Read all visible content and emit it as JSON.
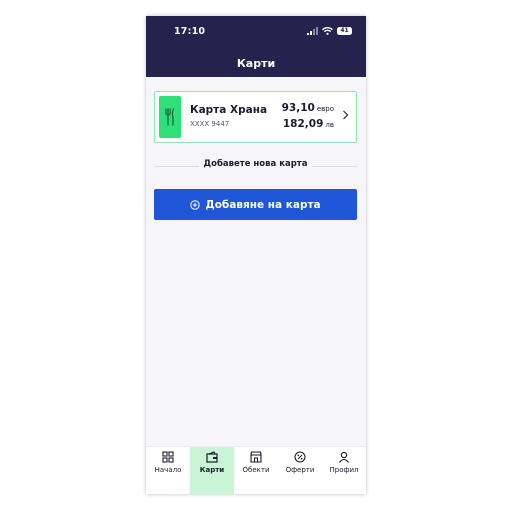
{
  "status_bar": {
    "time": "17:10",
    "battery": "41"
  },
  "header": {
    "title": "Карти"
  },
  "card": {
    "name": "Карта Храна",
    "number": "XXXX 9447",
    "balance_primary": "93,10",
    "balance_primary_unit": "евро",
    "balance_secondary": "182,09",
    "balance_secondary_unit": "лв",
    "accent_color": "#2ee07a"
  },
  "add_section": {
    "heading": "Добавете нова карта",
    "button_label": "Добавяне на карта",
    "button_color": "#1f56d8"
  },
  "tabs": [
    {
      "label": "Начало",
      "icon": "grid-icon",
      "active": false
    },
    {
      "label": "Карти",
      "icon": "wallet-card-icon",
      "active": true
    },
    {
      "label": "Обекти",
      "icon": "store-icon",
      "active": false
    },
    {
      "label": "Оферти",
      "icon": "discount-badge-icon",
      "active": false
    },
    {
      "label": "Профил",
      "icon": "user-icon",
      "active": false
    }
  ]
}
